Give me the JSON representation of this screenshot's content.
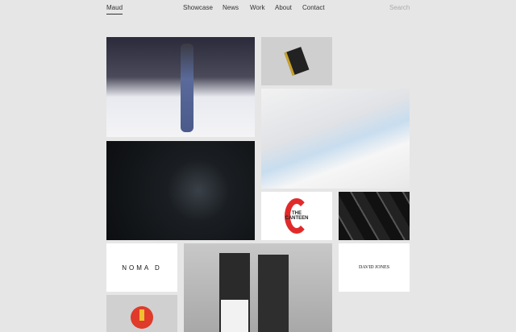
{
  "nav": {
    "brand": "Maud",
    "links": [
      "Showcase",
      "News",
      "Work",
      "About",
      "Contact"
    ],
    "search_placeholder": "Search"
  },
  "tiles": {
    "canteen": {
      "line1": "THE",
      "line2": "CANTEEN"
    },
    "nomad": "NOMA D",
    "david_jones": "DAVID JONES"
  }
}
